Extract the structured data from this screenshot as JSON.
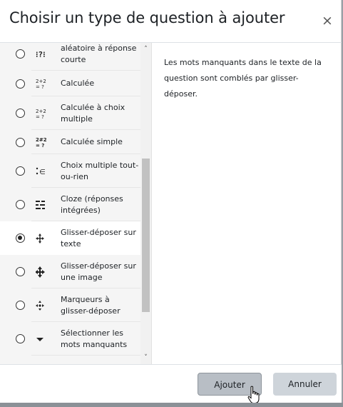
{
  "dialog": {
    "title": "Choisir un type de question à ajouter",
    "close_symbol": "×"
  },
  "question_types": [
    {
      "label": "aléatoire à réponse courte",
      "icon": "random-short-answer-icon",
      "selected": false
    },
    {
      "label": "Calculée",
      "icon": "calculated-icon",
      "selected": false
    },
    {
      "label": "Calculée à choix multiple",
      "icon": "calculated-multichoice-icon",
      "selected": false
    },
    {
      "label": "Calculée simple",
      "icon": "calculated-simple-icon",
      "selected": false
    },
    {
      "label": "Choix multiple tout-ou-rien",
      "icon": "multichoice-all-or-nothing-icon",
      "selected": false
    },
    {
      "label": "Cloze (réponses intégrées)",
      "icon": "cloze-icon",
      "selected": false
    },
    {
      "label": "Glisser-déposer sur texte",
      "icon": "drag-drop-text-icon",
      "selected": true
    },
    {
      "label": "Glisser-déposer sur une image",
      "icon": "drag-drop-image-icon",
      "selected": false
    },
    {
      "label": "Marqueurs à glisser-déposer",
      "icon": "drag-drop-markers-icon",
      "selected": false
    },
    {
      "label": "Sélectionner les mots manquants",
      "icon": "select-missing-words-icon",
      "selected": false
    }
  ],
  "description": "Les mots manquants dans le texte de la question sont comblés par glisser-déposer.",
  "footer": {
    "add_label": "Ajouter",
    "cancel_label": "Annuler"
  },
  "icons": {
    "scroll_up": "chevron-up-icon",
    "scroll_down": "chevron-down-icon",
    "cursor": "hand-pointer-icon"
  },
  "colors": {
    "selected_row": "#ffffff",
    "list_background": "#f5f5f5",
    "add_button": "#b8bec5",
    "cancel_button": "#ced4da"
  }
}
